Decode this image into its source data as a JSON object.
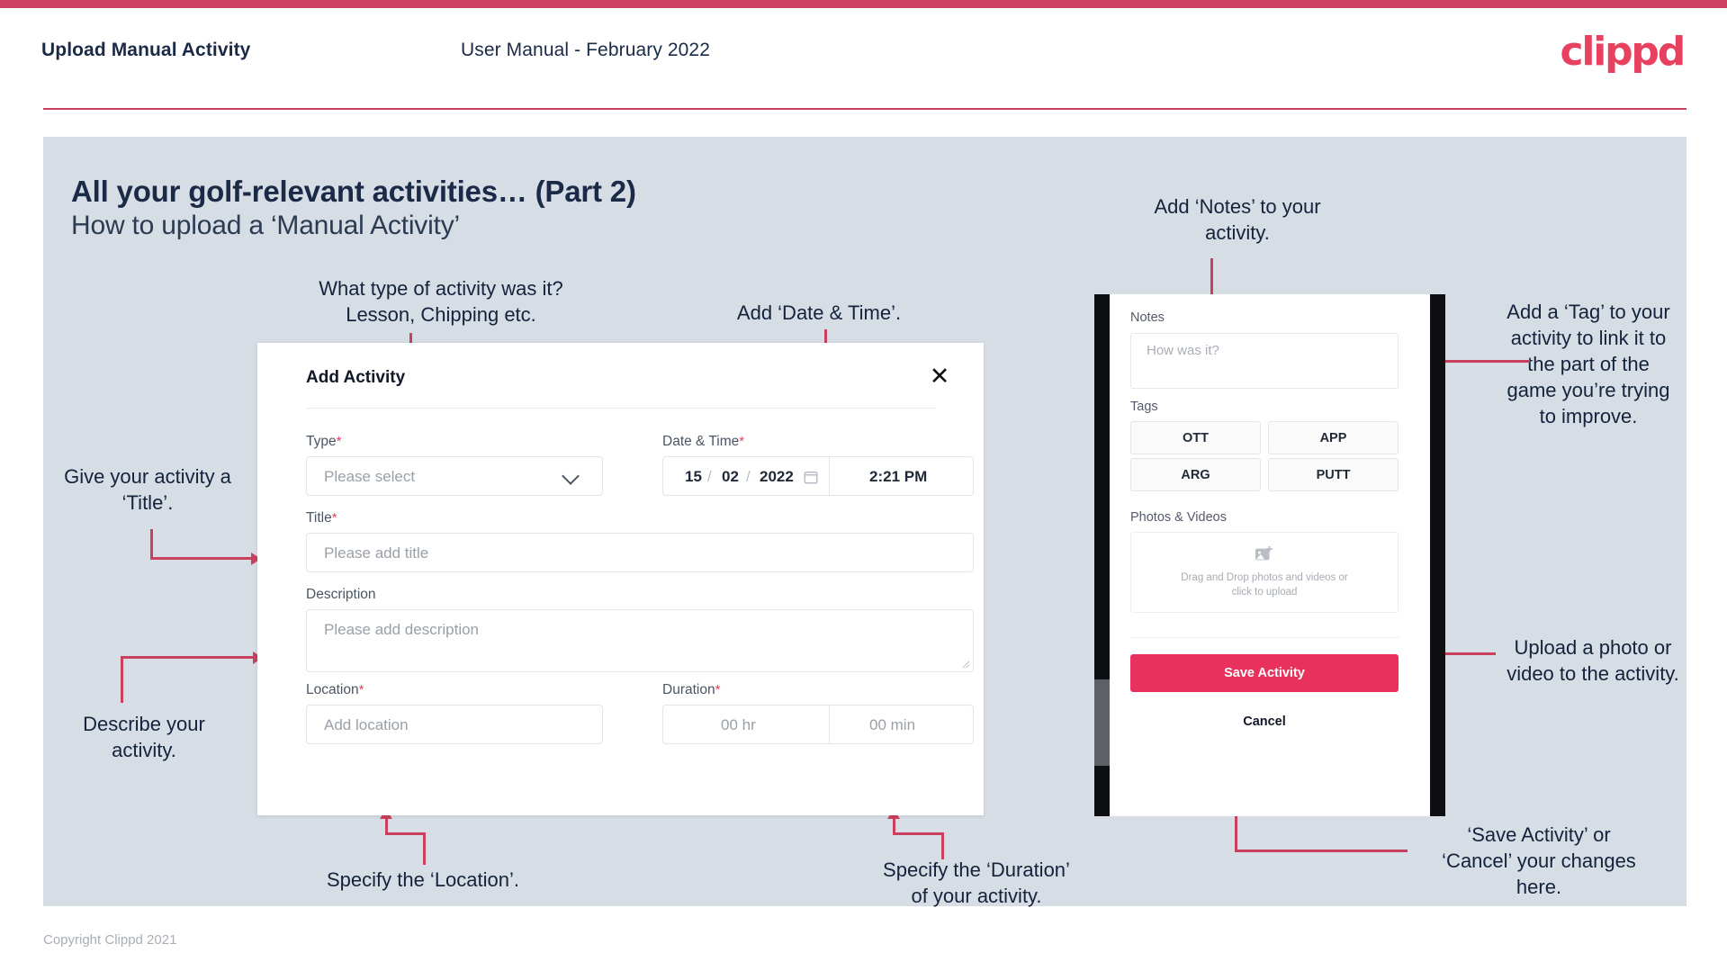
{
  "header": {
    "left_title": "Upload Manual Activity",
    "center_title": "User Manual - February 2022",
    "logo": "clippd"
  },
  "slide": {
    "title_line1": "All your golf-relevant activities… (Part 2)",
    "title_line2": "How to upload a ‘Manual Activity’"
  },
  "dialog": {
    "title": "Add Activity",
    "close_icon": "close-icon",
    "fields": {
      "type_label": "Type",
      "type_placeholder": "Please select",
      "datetime_label": "Date & Time",
      "date_day": "15",
      "date_sep1": "/",
      "date_month": "02",
      "date_sep2": "/",
      "date_year": "2022",
      "calendar_icon": "calendar-icon",
      "time_value": "2:21 PM",
      "title_label": "Title",
      "title_placeholder": "Please add title",
      "description_label": "Description",
      "description_placeholder": "Please add description",
      "location_label": "Location",
      "location_placeholder": "Add location",
      "duration_label": "Duration",
      "duration_hours_placeholder": "00 hr",
      "duration_minutes_placeholder": "00 min"
    },
    "required_marker": "*"
  },
  "phone": {
    "notes_label": "Notes",
    "notes_placeholder": "How was it?",
    "tags_label": "Tags",
    "tags": [
      "OTT",
      "APP",
      "ARG",
      "PUTT"
    ],
    "photos_label": "Photos & Videos",
    "upload_icon": "image-add-icon",
    "upload_text_line1": "Drag and Drop photos and videos or",
    "upload_text_line2": "click to upload",
    "save_label": "Save Activity",
    "cancel_label": "Cancel"
  },
  "annotations": {
    "type": "What type of activity was it?\nLesson, Chipping etc.",
    "datetime": "Add ‘Date & Time’.",
    "title": "Give your activity a\n‘Title’.",
    "description": "Describe your\nactivity.",
    "location": "Specify the ‘Location’.",
    "duration": "Specify the ‘Duration’\nof your activity.",
    "notes": "Add ‘Notes’ to your\nactivity.",
    "tags": "Add a ‘Tag’ to your\nactivity to link it to\nthe part of the\ngame you’re trying\nto improve.",
    "upload": "Upload a photo or\nvideo to the activity.",
    "save_cancel": "‘Save Activity’ or\n‘Cancel’ your changes\nhere."
  },
  "footer": {
    "copyright": "Copyright Clippd 2021"
  },
  "colors": {
    "brand_pink": "#e8405f",
    "arrow_pink": "#c9405e",
    "slide_bg": "#d6dde5",
    "navy_text": "#14223c"
  }
}
